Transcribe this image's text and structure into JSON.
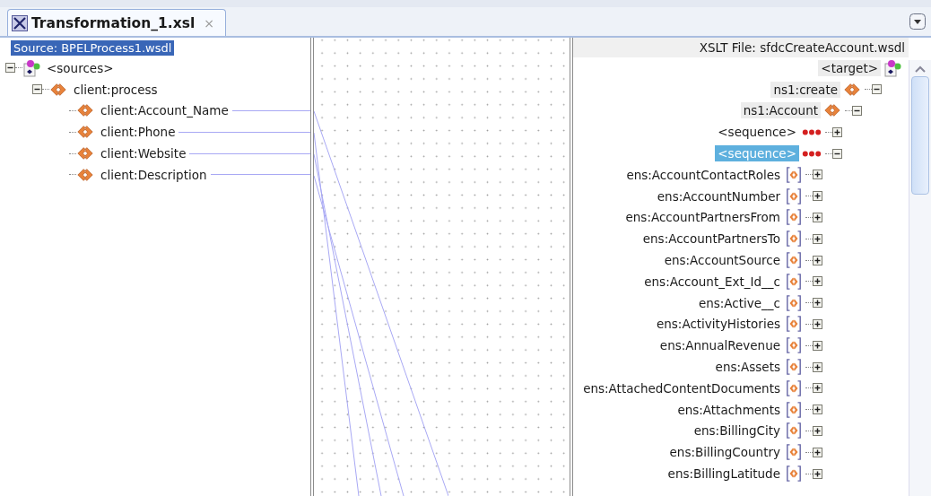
{
  "tab": {
    "title": "Transformation_1.xsl",
    "close": "×",
    "selected": true
  },
  "source": {
    "header": "Source: BPELProcess1.wsdl",
    "tree": [
      {
        "label": "<sources>",
        "kind": "root",
        "expanded": true,
        "children": [
          {
            "label": "client:process",
            "kind": "element",
            "expanded": true,
            "children": [
              {
                "label": "client:Account_Name",
                "kind": "element",
                "mapped": true
              },
              {
                "label": "client:Phone",
                "kind": "element",
                "mapped": true
              },
              {
                "label": "client:Website",
                "kind": "element",
                "mapped": true
              },
              {
                "label": "client:Description",
                "kind": "element",
                "mapped": true
              }
            ]
          }
        ]
      }
    ]
  },
  "target": {
    "header": "XSLT File: sfdcCreateAccount.wsdl",
    "tree": [
      {
        "label": "<target>",
        "kind": "root",
        "shaded": true,
        "children": [
          {
            "label": "ns1:create",
            "kind": "element",
            "shaded": true,
            "expanded": true,
            "children": [
              {
                "label": "ns1:Account",
                "kind": "element",
                "shaded": true,
                "expanded": true,
                "children": [
                  {
                    "label": "<sequence>",
                    "kind": "sequence",
                    "expanded": false,
                    "selected": false
                  },
                  {
                    "label": "<sequence>",
                    "kind": "sequence",
                    "expanded": true,
                    "selected": true,
                    "children": [
                      {
                        "label": "ens:AccountContactRoles",
                        "kind": "field",
                        "expanded": false
                      },
                      {
                        "label": "ens:AccountNumber",
                        "kind": "field",
                        "expanded": false
                      },
                      {
                        "label": "ens:AccountPartnersFrom",
                        "kind": "field",
                        "expanded": false
                      },
                      {
                        "label": "ens:AccountPartnersTo",
                        "kind": "field",
                        "expanded": false
                      },
                      {
                        "label": "ens:AccountSource",
                        "kind": "field",
                        "expanded": false
                      },
                      {
                        "label": "ens:Account_Ext_Id__c",
                        "kind": "field",
                        "expanded": false
                      },
                      {
                        "label": "ens:Active__c",
                        "kind": "field",
                        "expanded": false
                      },
                      {
                        "label": "ens:ActivityHistories",
                        "kind": "field",
                        "expanded": false
                      },
                      {
                        "label": "ens:AnnualRevenue",
                        "kind": "field",
                        "expanded": false
                      },
                      {
                        "label": "ens:Assets",
                        "kind": "field",
                        "expanded": false
                      },
                      {
                        "label": "ens:AttachedContentDocuments",
                        "kind": "field",
                        "expanded": false
                      },
                      {
                        "label": "ens:Attachments",
                        "kind": "field",
                        "expanded": false
                      },
                      {
                        "label": "ens:BillingCity",
                        "kind": "field",
                        "expanded": false
                      },
                      {
                        "label": "ens:BillingCountry",
                        "kind": "field",
                        "expanded": false
                      },
                      {
                        "label": "ens:BillingLatitude",
                        "kind": "field",
                        "expanded": false
                      }
                    ]
                  }
                ]
              }
            ]
          }
        ]
      }
    ]
  }
}
